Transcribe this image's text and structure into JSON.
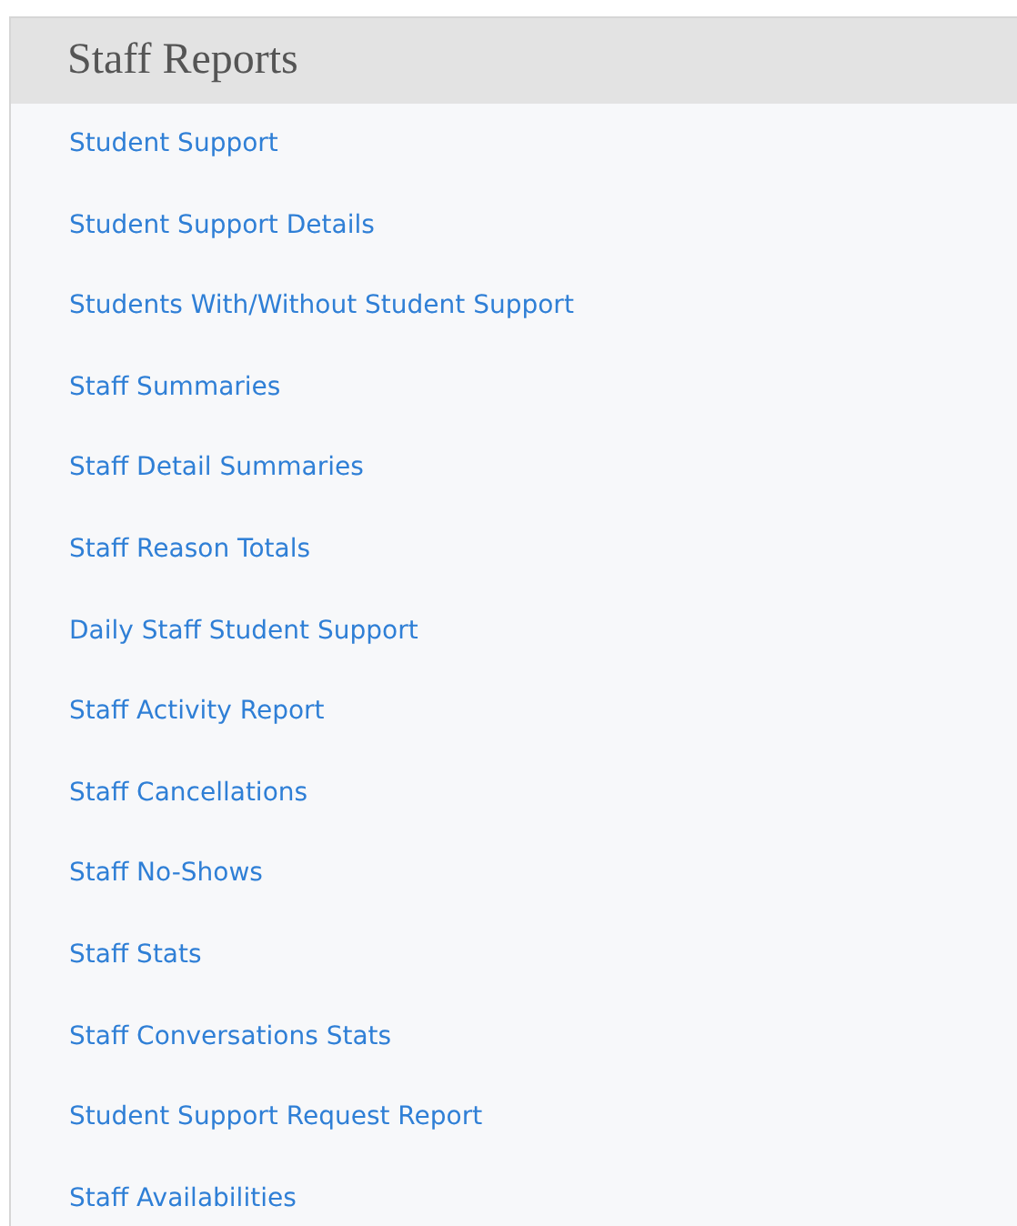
{
  "panel": {
    "title": "Staff Reports",
    "links": [
      {
        "label": "Student Support"
      },
      {
        "label": "Student Support Details"
      },
      {
        "label": "Students With/Without Student Support"
      },
      {
        "label": "Staff Summaries"
      },
      {
        "label": "Staff Detail Summaries"
      },
      {
        "label": "Staff Reason Totals"
      },
      {
        "label": "Daily Staff Student Support"
      },
      {
        "label": "Staff Activity Report"
      },
      {
        "label": "Staff Cancellations"
      },
      {
        "label": "Staff No-Shows"
      },
      {
        "label": "Staff Stats"
      },
      {
        "label": "Staff Conversations Stats"
      },
      {
        "label": "Student Support Request Report"
      },
      {
        "label": "Staff Availabilities"
      }
    ]
  }
}
